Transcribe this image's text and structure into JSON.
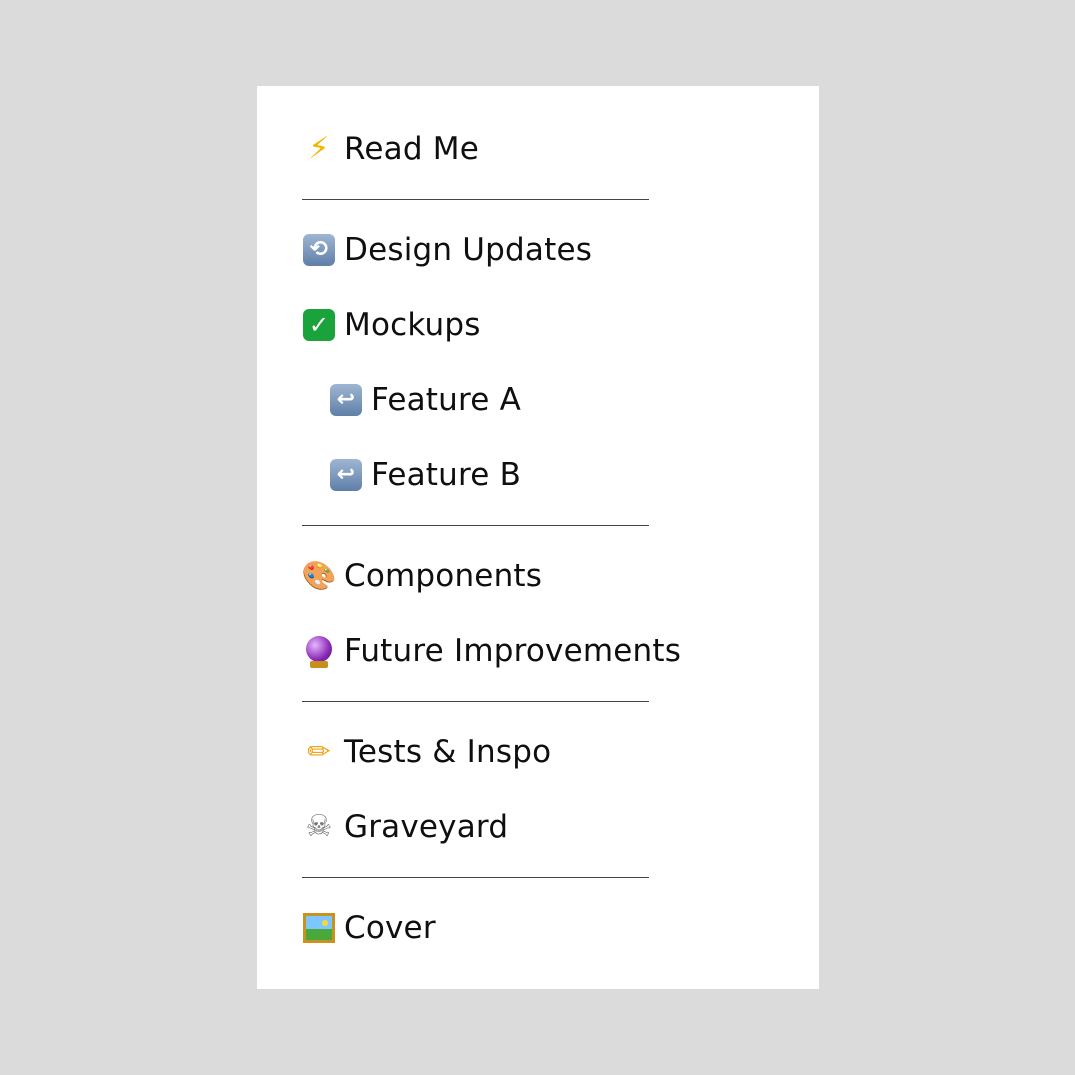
{
  "pages": [
    {
      "label": "Read Me",
      "icon": "lightning-bolt-icon",
      "indent": false
    },
    {
      "label": "Design Updates",
      "icon": "counterclockwise-arrows-icon",
      "indent": false
    },
    {
      "label": "Mockups",
      "icon": "check-mark-button-icon",
      "indent": false
    },
    {
      "label": "Feature A",
      "icon": "right-arrow-curving-left-icon",
      "indent": true
    },
    {
      "label": "Feature B",
      "icon": "right-arrow-curving-left-icon",
      "indent": true
    },
    {
      "label": "Components",
      "icon": "artist-palette-icon",
      "indent": false
    },
    {
      "label": "Future Improvements",
      "icon": "crystal-ball-icon",
      "indent": false
    },
    {
      "label": "Tests & Inspo",
      "icon": "pencil-icon",
      "indent": false
    },
    {
      "label": "Graveyard",
      "icon": "skull-and-crossbones-icon",
      "indent": false
    },
    {
      "label": "Cover",
      "icon": "framed-picture-icon",
      "indent": false
    }
  ],
  "colors": {
    "background": "#dbdbdb",
    "panel": "#ffffff",
    "text": "#0f0f0f",
    "divider": "#444444"
  }
}
